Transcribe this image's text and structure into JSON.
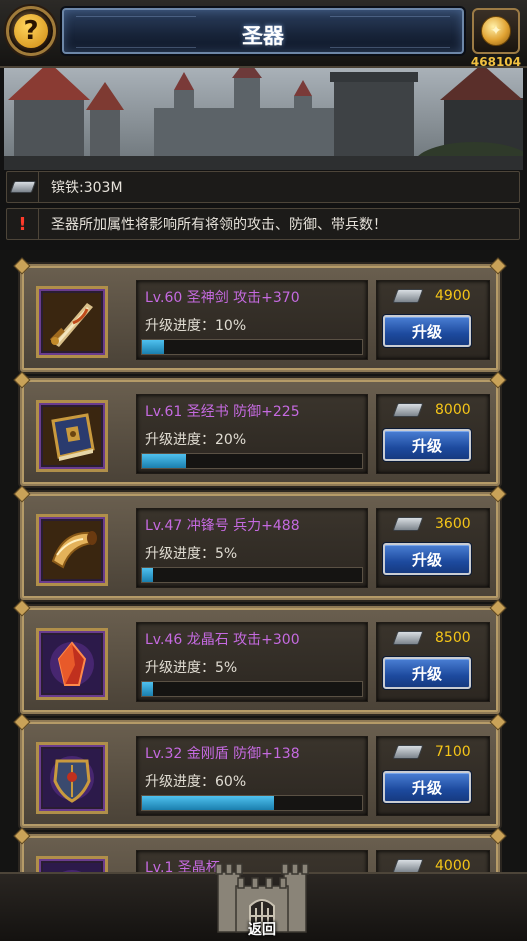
{
  "header": {
    "title": "圣器",
    "help_label": "?",
    "gold": "468104"
  },
  "resource": {
    "iron_label": "镔铁:303M"
  },
  "notice": {
    "icon": "!",
    "text": "圣器所加属性将影响所有将领的攻击、防御、带兵数！"
  },
  "items": [
    {
      "name": "Lv.60 圣神剑 攻击+370",
      "progress_label": "升级进度：10%",
      "progress": 0.1,
      "cost": "4900",
      "button": "升级",
      "icon": "sword-icon"
    },
    {
      "name": "Lv.61 圣经书 防御+225",
      "progress_label": "升级进度：20%",
      "progress": 0.2,
      "cost": "8000",
      "button": "升级",
      "icon": "book-icon"
    },
    {
      "name": "Lv.47 冲锋号 兵力+488",
      "progress_label": "升级进度：5%",
      "progress": 0.05,
      "cost": "3600",
      "button": "升级",
      "icon": "horn-icon"
    },
    {
      "name": "Lv.46 龙晶石 攻击+300",
      "progress_label": "升级进度：5%",
      "progress": 0.05,
      "cost": "8500",
      "button": "升级",
      "icon": "crystal-icon"
    },
    {
      "name": "Lv.32 金刚盾 防御+138",
      "progress_label": "升级进度：60%",
      "progress": 0.6,
      "cost": "7100",
      "button": "升级",
      "icon": "shield-icon"
    },
    {
      "name": "Lv.1 圣晶杯",
      "cost": "4000",
      "icon": "chalice-icon"
    }
  ],
  "footer": {
    "back_label": "返回"
  },
  "colors": {
    "item_title": "#c56ae0",
    "cost": "#f5c518",
    "button": "#1d4a9e",
    "progress": "#2aa0d6"
  }
}
